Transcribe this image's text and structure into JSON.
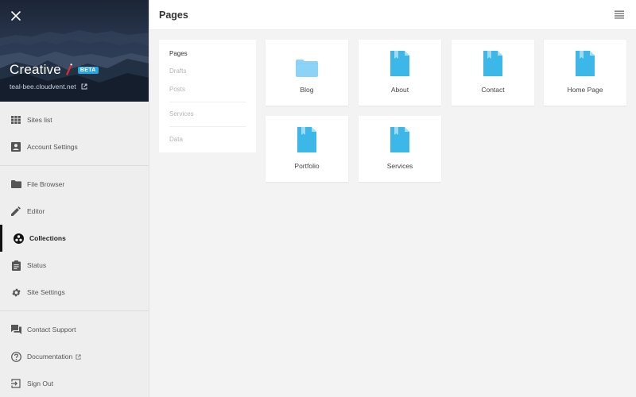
{
  "sidebar": {
    "site_title": "Creative",
    "badge": "BETA",
    "site_url": "teal-bee.cloudvent.net",
    "items": [
      {
        "label": "Sites list",
        "icon": "grid-icon"
      },
      {
        "label": "Account Settings",
        "icon": "account-box-icon"
      },
      {
        "label": "File Browser",
        "icon": "folder-icon"
      },
      {
        "label": "Editor",
        "icon": "pencil-icon"
      },
      {
        "label": "Collections",
        "icon": "collections-icon",
        "active": true
      },
      {
        "label": "Status",
        "icon": "clipboard-icon"
      },
      {
        "label": "Site Settings",
        "icon": "gear-icon"
      },
      {
        "label": "Contact Support",
        "icon": "chat-icon"
      },
      {
        "label": "Documentation",
        "icon": "help-circle-icon",
        "external": true
      },
      {
        "label": "Sign Out",
        "icon": "sign-out-icon"
      }
    ]
  },
  "header": {
    "title": "Pages"
  },
  "subnav": {
    "items": [
      {
        "label": "Pages",
        "active": true
      },
      {
        "label": "Drafts"
      },
      {
        "label": "Posts"
      },
      {
        "label": "Services"
      },
      {
        "label": "Data"
      }
    ]
  },
  "cards": [
    {
      "label": "Blog",
      "type": "folder"
    },
    {
      "label": "About",
      "type": "file"
    },
    {
      "label": "Contact",
      "type": "file"
    },
    {
      "label": "Home Page",
      "type": "file"
    },
    {
      "label": "Portfolio",
      "type": "file"
    },
    {
      "label": "Services",
      "type": "file"
    }
  ],
  "colors": {
    "accent": "#2aa6df",
    "file_icon": "#3bb8e8",
    "folder_icon": "#8dd3f7"
  }
}
